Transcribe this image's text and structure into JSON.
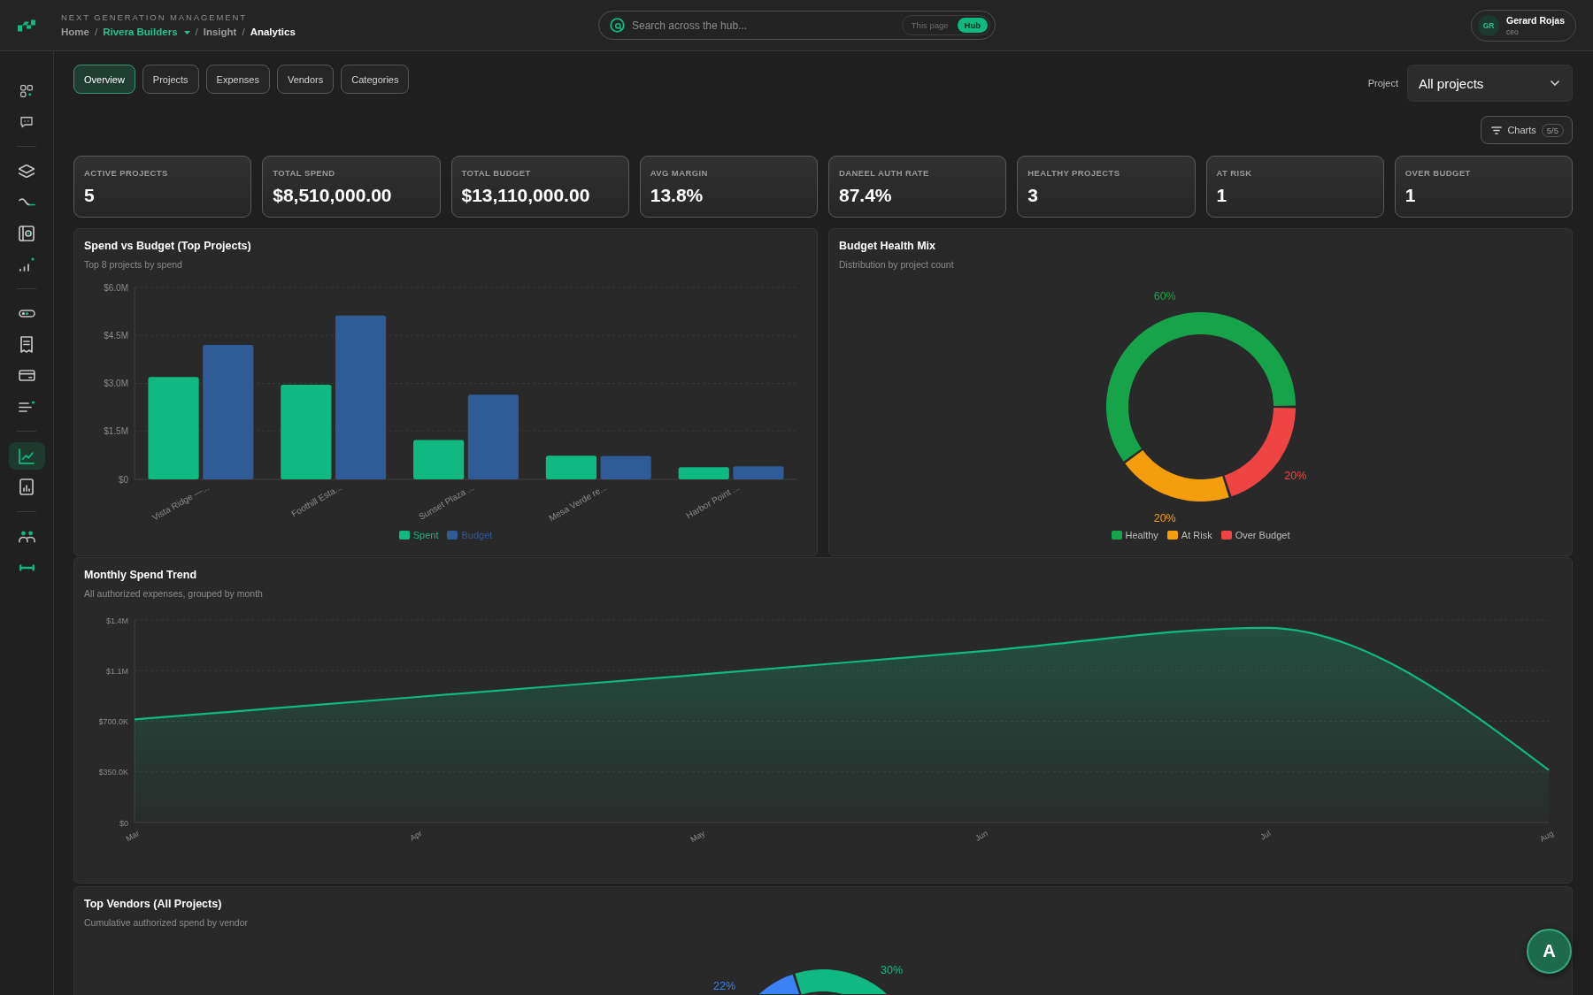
{
  "topbar": {
    "tagline": "NEXT GENERATION MANAGEMENT",
    "breadcrumb": [
      {
        "label": "Home",
        "kind": "link"
      },
      {
        "separator": "/",
        "label": "Rivera Builders",
        "kind": "dropdown"
      },
      {
        "separator": "/",
        "label": "Insight",
        "kind": "link"
      },
      {
        "separator": "/",
        "label": "Analytics",
        "kind": "current"
      }
    ],
    "search": {
      "placeholder": "Search across the hub...",
      "scopes": [
        {
          "label": "This page",
          "selected": false
        },
        {
          "label": "Hub",
          "selected": true
        }
      ]
    },
    "user": {
      "initials": "GR",
      "name": "Gerard Rojas",
      "role": "ceo"
    }
  },
  "sidebar": {
    "groups": [
      {
        "items": [
          {
            "selected": false
          },
          {
            "selected": false
          }
        ]
      },
      {
        "items": [
          {
            "selected": false
          },
          {
            "selected": false
          },
          {
            "selected": false
          },
          {
            "selected": false
          }
        ]
      },
      {
        "items": [
          {
            "selected": false
          },
          {
            "selected": false
          },
          {
            "selected": false
          },
          {
            "selected": false
          }
        ]
      },
      {
        "items": [
          {
            "selected": true
          },
          {
            "selected": false
          }
        ]
      },
      {
        "items": [
          {
            "selected": false
          },
          {
            "selected": false
          }
        ]
      }
    ]
  },
  "tabs": [
    {
      "label": "Overview",
      "selected": true
    },
    {
      "label": "Projects",
      "selected": false
    },
    {
      "label": "Expenses",
      "selected": false
    },
    {
      "label": "Vendors",
      "selected": false
    },
    {
      "label": "Categories",
      "selected": false
    }
  ],
  "project_filter": {
    "label": "Project",
    "value": "All projects"
  },
  "charts_button": {
    "label": "Charts",
    "count": "5/5"
  },
  "kpis": [
    {
      "label": "ACTIVE PROJECTS",
      "value": "5"
    },
    {
      "label": "TOTAL SPEND",
      "value": "$8,510,000.00"
    },
    {
      "label": "TOTAL BUDGET",
      "value": "$13,110,000.00"
    },
    {
      "label": "AVG MARGIN",
      "value": "13.8%"
    },
    {
      "label": "DANEEL AUTH RATE",
      "value": "87.4%"
    },
    {
      "label": "HEALTHY PROJECTS",
      "value": "3"
    },
    {
      "label": "AT RISK",
      "value": "1"
    },
    {
      "label": "OVER BUDGET",
      "value": "1"
    }
  ],
  "spend_vs_budget": {
    "title": "Spend vs Budget (Top Projects)",
    "subtitle": "Top 8 projects by spend",
    "chart_data": {
      "type": "bar",
      "categories": [
        "Vista Ridge —...",
        "Foothill Esta...",
        "Sunset Plaza ...",
        "Mesa Verde re...",
        "Harbor Point ..."
      ],
      "series": [
        {
          "name": "Spent",
          "color": "#10b981",
          "values": [
            3200000,
            2960000,
            1230000,
            740000,
            380000
          ]
        },
        {
          "name": "Budget",
          "color": "#2f5b96",
          "values": [
            4200000,
            5120000,
            2650000,
            730000,
            410000
          ]
        }
      ],
      "ylim": [
        0,
        6000000
      ],
      "yticks": [
        {
          "value": 0,
          "label": "$0"
        },
        {
          "value": 1500000,
          "label": "$1.5M"
        },
        {
          "value": 3000000,
          "label": "$3.0M"
        },
        {
          "value": 4500000,
          "label": "$4.5M"
        },
        {
          "value": 6000000,
          "label": "$6.0M"
        }
      ],
      "grid": true,
      "legend": "bottom"
    }
  },
  "budget_health": {
    "title": "Budget Health Mix",
    "subtitle": "Distribution by project count",
    "chart_data": {
      "type": "donut",
      "categories": [
        "Healthy",
        "At Risk",
        "Over Budget"
      ],
      "values": [
        60,
        20,
        20
      ],
      "value_labels": [
        "60%",
        "20%",
        "20%"
      ],
      "legend": "bottom"
    },
    "slices": [
      {
        "color": "#16a34a"
      },
      {
        "color": "#f59e0b"
      },
      {
        "color": "#ef4444"
      }
    ]
  },
  "monthly_spend": {
    "title": "Monthly Spend Trend",
    "subtitle": "All authorized expenses, grouped by month",
    "chart_data": {
      "type": "area",
      "categories": [
        "Mar",
        "Apr",
        "May",
        "Jun",
        "Jul",
        "Aug"
      ],
      "values": [
        713000,
        868000,
        1023000,
        1185000,
        1346000,
        363000
      ],
      "ylim": [
        0,
        1400000
      ],
      "yticks": [
        {
          "value": 0,
          "label": "$0"
        },
        {
          "value": 350000,
          "label": "$350.0K"
        },
        {
          "value": 700000,
          "label": "$700.0K"
        },
        {
          "value": 1050000,
          "label": "$1.1M"
        },
        {
          "value": 1400000,
          "label": "$1.4M"
        }
      ],
      "grid": true
    }
  },
  "top_vendors": {
    "title": "Top Vendors (All Projects)",
    "subtitle": "Cumulative authorized spend by vendor",
    "slices": [
      {
        "label": "30%",
        "color": "#10b981"
      },
      {
        "label": "22%",
        "color": "#3b82f6"
      }
    ]
  },
  "assistant_button": {
    "label": "A"
  }
}
